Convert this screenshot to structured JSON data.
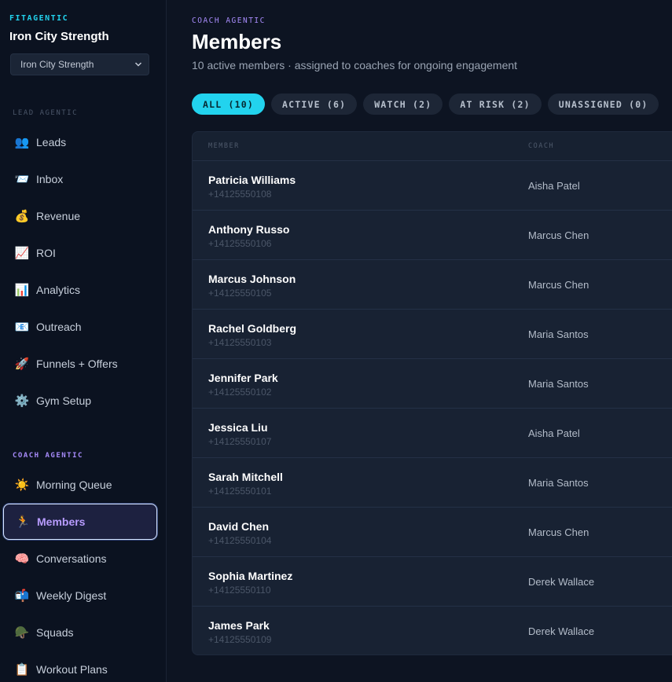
{
  "brand": {
    "tag": "FITAGENTIC",
    "name": "Iron City Strength"
  },
  "gym_select": {
    "value": "Iron City Strength"
  },
  "sidebar": {
    "lead_label": "LEAD AGENTIC",
    "lead_items": [
      {
        "emoji": "👥",
        "label": "Leads",
        "icon": "people-icon"
      },
      {
        "emoji": "📨",
        "label": "Inbox",
        "icon": "inbox-icon"
      },
      {
        "emoji": "💰",
        "label": "Revenue",
        "icon": "money-bag-icon"
      },
      {
        "emoji": "📈",
        "label": "ROI",
        "icon": "trend-up-icon"
      },
      {
        "emoji": "📊",
        "label": "Analytics",
        "icon": "bar-chart-icon"
      },
      {
        "emoji": "📧",
        "label": "Outreach",
        "icon": "email-icon"
      },
      {
        "emoji": "🚀",
        "label": "Funnels + Offers",
        "icon": "rocket-icon"
      },
      {
        "emoji": "⚙️",
        "label": "Gym Setup",
        "icon": "gear-icon"
      }
    ],
    "coach_label": "COACH AGENTIC",
    "coach_items": [
      {
        "emoji": "☀️",
        "label": "Morning Queue",
        "icon": "sun-icon"
      },
      {
        "emoji": "🏃",
        "label": "Members",
        "icon": "runner-icon"
      },
      {
        "emoji": "🧠",
        "label": "Conversations",
        "icon": "brain-icon"
      },
      {
        "emoji": "📬",
        "label": "Weekly Digest",
        "icon": "mailbox-icon"
      },
      {
        "emoji": "🪖",
        "label": "Squads",
        "icon": "helmet-icon"
      },
      {
        "emoji": "📋",
        "label": "Workout Plans",
        "icon": "clipboard-icon"
      }
    ]
  },
  "header": {
    "eyebrow": "COACH AGENTIC",
    "title": "Members",
    "subtitle": "10 active members · assigned to coaches for ongoing engagement"
  },
  "filters": [
    {
      "label": "ALL (10)",
      "active": true
    },
    {
      "label": "ACTIVE (6)",
      "active": false
    },
    {
      "label": "WATCH (2)",
      "active": false
    },
    {
      "label": "AT RISK (2)",
      "active": false
    },
    {
      "label": "UNASSIGNED (0)",
      "active": false
    }
  ],
  "table": {
    "columns": {
      "member": "MEMBER",
      "coach": "COACH"
    },
    "rows": [
      {
        "name": "Patricia Williams",
        "phone": "+14125550108",
        "coach": "Aisha Patel"
      },
      {
        "name": "Anthony Russo",
        "phone": "+14125550106",
        "coach": "Marcus Chen"
      },
      {
        "name": "Marcus Johnson",
        "phone": "+14125550105",
        "coach": "Marcus Chen"
      },
      {
        "name": "Rachel Goldberg",
        "phone": "+14125550103",
        "coach": "Maria Santos"
      },
      {
        "name": "Jennifer Park",
        "phone": "+14125550102",
        "coach": "Maria Santos"
      },
      {
        "name": "Jessica Liu",
        "phone": "+14125550107",
        "coach": "Aisha Patel"
      },
      {
        "name": "Sarah Mitchell",
        "phone": "+14125550101",
        "coach": "Maria Santos"
      },
      {
        "name": "David Chen",
        "phone": "+14125550104",
        "coach": "Marcus Chen"
      },
      {
        "name": "Sophia Martinez",
        "phone": "+14125550110",
        "coach": "Derek Wallace"
      },
      {
        "name": "James Park",
        "phone": "+14125550109",
        "coach": "Derek Wallace"
      }
    ]
  },
  "colors": {
    "accent_cyan": "#22d3ee",
    "accent_purple": "#a78bfa",
    "background": "#0d1422"
  }
}
